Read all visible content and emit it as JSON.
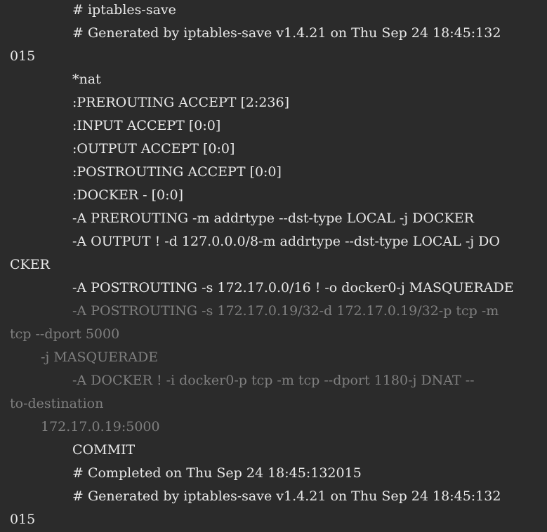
{
  "terminal": {
    "lines": [
      {
        "text": "# iptables-save",
        "dim": false
      },
      {
        "text": "# Generated by iptables-save v1.4.21 on Thu Sep 24 18:45:132",
        "dim": false
      },
      {
        "text": "015",
        "dim": false
      },
      {
        "text": "*nat",
        "dim": false
      },
      {
        "text": ":PREROUTING ACCEPT [2:236]",
        "dim": false
      },
      {
        "text": ":INPUT ACCEPT [0:0]",
        "dim": false
      },
      {
        "text": ":OUTPUT ACCEPT [0:0]",
        "dim": false
      },
      {
        "text": ":POSTROUTING ACCEPT [0:0]",
        "dim": false
      },
      {
        "text": ":DOCKER - [0:0]",
        "dim": false
      },
      {
        "text": "-A PREROUTING -m addrtype --dst-type LOCAL -j DOCKER",
        "dim": false
      },
      {
        "text": "-A OUTPUT ! -d 127.0.0.0/8-m addrtype --dst-type LOCAL -j DO",
        "dim": false
      },
      {
        "text": "CKER",
        "dim": false
      },
      {
        "text": "-A POSTROUTING -s 172.17.0.0/16 ! -o docker0-j MASQUERADE",
        "dim": false
      },
      {
        "text": "-A POSTROUTING -s 172.17.0.19/32-d 172.17.0.19/32-p tcp -m",
        "dim": true
      },
      {
        "text": "tcp --dport 5000",
        "dim": true
      },
      {
        "text": "-j MASQUERADE",
        "dim": true
      },
      {
        "text": "-A DOCKER ! -i docker0-p tcp -m tcp --dport 1180-j DNAT --",
        "dim": true
      },
      {
        "text": "to-destination",
        "dim": true
      },
      {
        "text": "172.17.0.19:5000",
        "dim": true
      },
      {
        "text": "COMMIT",
        "dim": false
      },
      {
        "text": "# Completed on Thu Sep 24 18:45:132015",
        "dim": false
      },
      {
        "text": "# Generated by iptables-save v1.4.21 on Thu Sep 24 18:45:132",
        "dim": false
      },
      {
        "text": "015",
        "dim": false
      }
    ]
  }
}
